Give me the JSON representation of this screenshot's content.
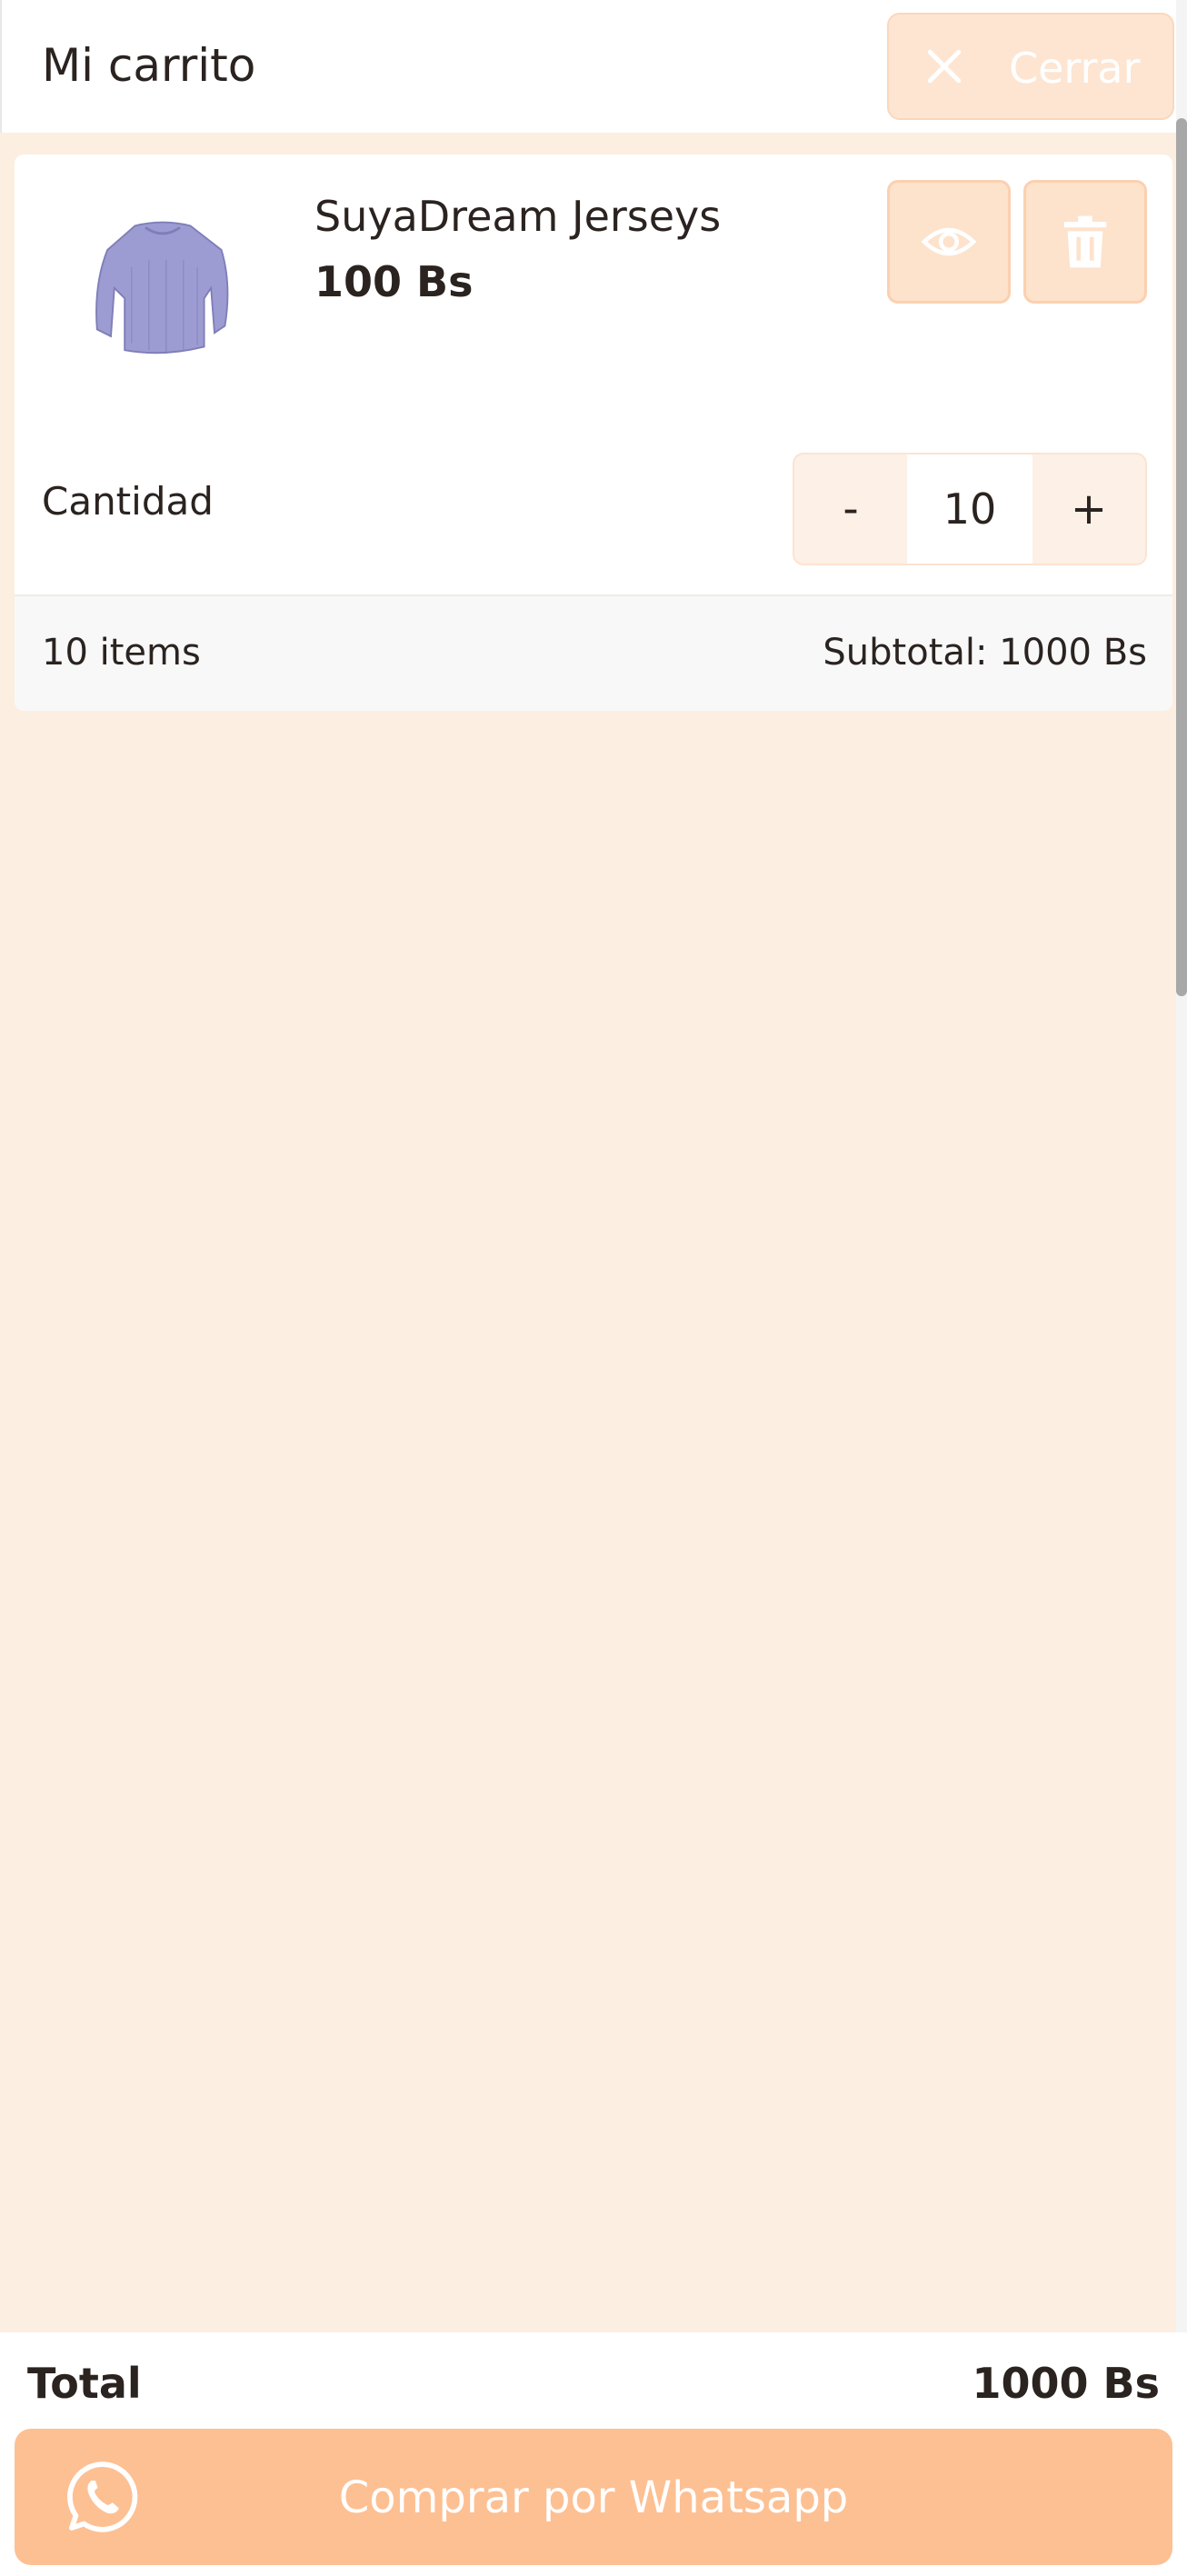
{
  "header": {
    "title": "Mi carrito",
    "close_label": "Cerrar"
  },
  "cart_item": {
    "name": "SuyaDream Jerseys",
    "price": "100 Bs",
    "quantity_label": "Cantidad",
    "quantity": "10",
    "minus_label": "-",
    "plus_label": "+",
    "items_count": "10 items",
    "subtotal": "Subtotal: 1000 Bs",
    "image_icon": "sweater-image"
  },
  "footer": {
    "total_label": "Total",
    "total_value": "1000 Bs",
    "buy_label": "Comprar por Whatsapp"
  },
  "colors": {
    "background": "#fdeee2",
    "accent": "#fdc093",
    "button_light": "#fde2cc"
  }
}
